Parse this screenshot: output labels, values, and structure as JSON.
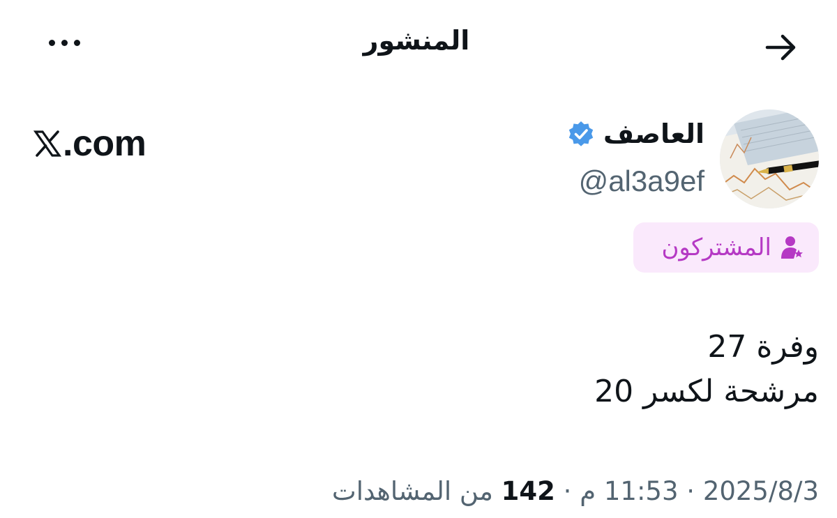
{
  "header": {
    "title": "المنشور",
    "back_icon": "arrow-right-icon",
    "more_icon": "more-horizontal-icon"
  },
  "author": {
    "display_name": "العاصف",
    "handle": "@al3a9ef",
    "verified_icon": "verified-badge-icon",
    "verified_color": "#4a99e9",
    "avatar_icon": "avatar-chart-pen-image"
  },
  "watermark": {
    "text": ".com"
  },
  "audience_badge": {
    "label": "المشتركون",
    "icon": "subscriber-star-icon",
    "color": "#b539c4",
    "background": "#fae9fc"
  },
  "post": {
    "line1": "وفرة 27",
    "line2": "مرشحة لكسر 20"
  },
  "meta": {
    "date": "2025/8/3",
    "time": "11:53 م",
    "separator": "·",
    "views_count": "142",
    "views_label": "من المشاهدات"
  }
}
